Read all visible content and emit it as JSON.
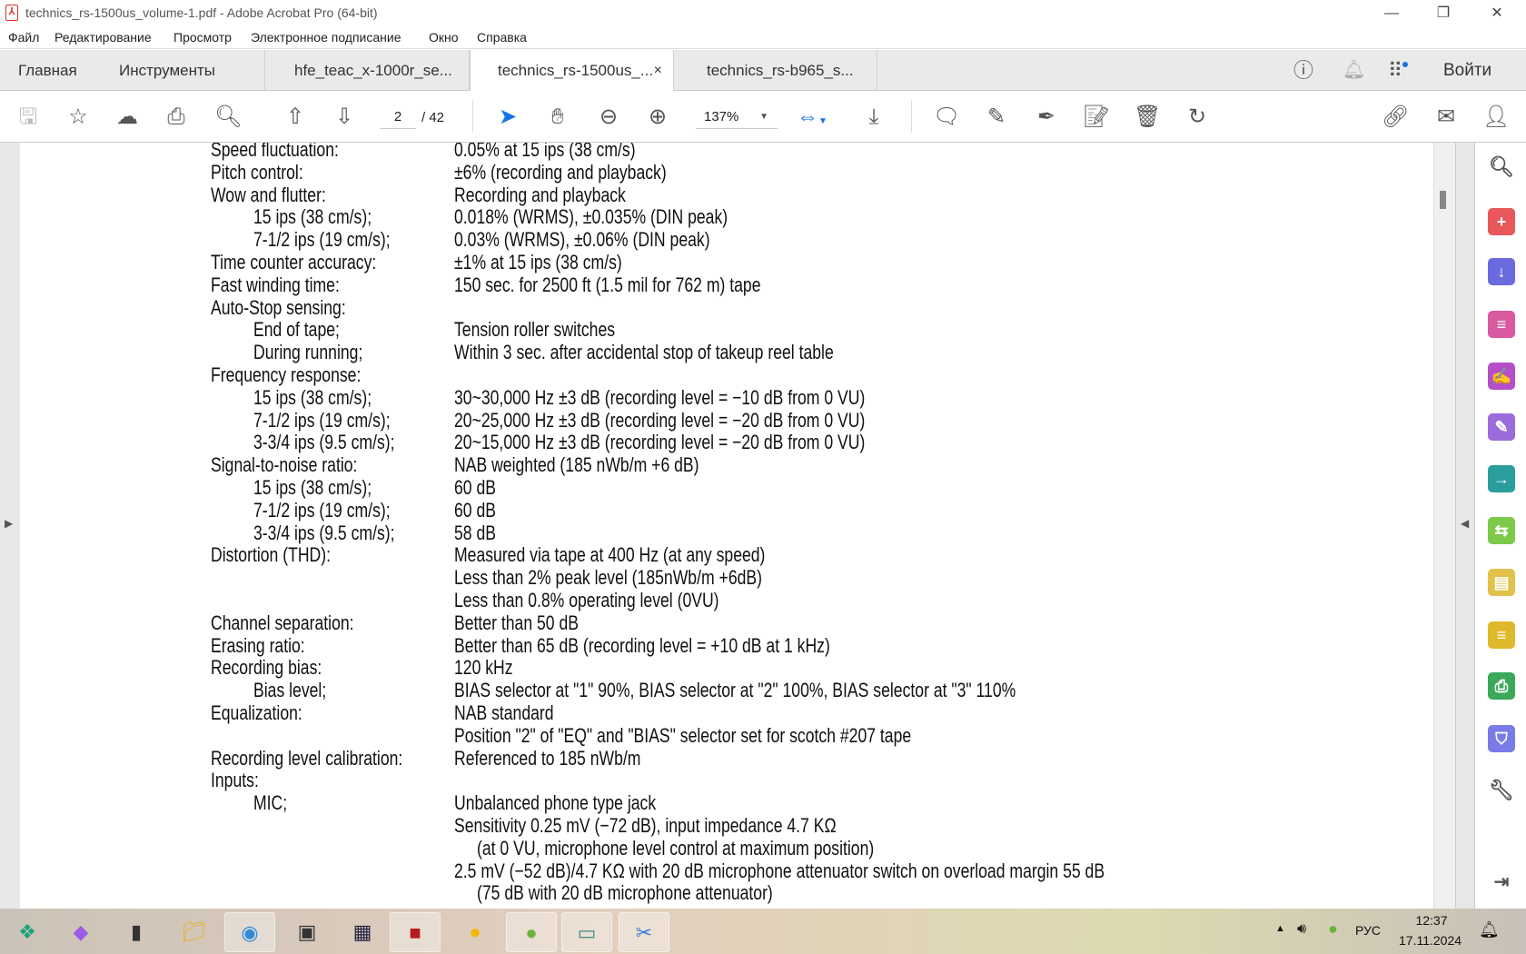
{
  "window": {
    "title": "technics_rs-1500us_volume-1.pdf - Adobe Acrobat Pro (64-bit)"
  },
  "menu": [
    "Файл",
    "Редактирование",
    "Просмотр",
    "Электронное подписание",
    "Окно",
    "Справка"
  ],
  "nav": {
    "home": "Главная",
    "tools": "Инструменты",
    "signin": "Войти"
  },
  "tabs": [
    {
      "label": "hfe_teac_x-1000r_se...",
      "active": false
    },
    {
      "label": "technics_rs-1500us_...",
      "active": true,
      "close": "×"
    },
    {
      "label": "technics_rs-b965_s...",
      "active": false
    }
  ],
  "toolbar": {
    "page_current": "2",
    "page_total": "/ 42",
    "zoom": "137%"
  },
  "document": {
    "rows": [
      {
        "label": "Speed fluctuation:",
        "value": "0.05% at 15 ips (38 cm/s)"
      },
      {
        "label": "Pitch control:",
        "value": "±6% (recording and playback)"
      },
      {
        "label": "Wow and flutter:",
        "value": "Recording and playback"
      },
      {
        "label": "15 ips (38 cm/s);",
        "sub": true,
        "value": "0.018% (WRMS), ±0.035% (DIN peak)"
      },
      {
        "label": "7-1/2 ips (19 cm/s);",
        "sub": true,
        "value": "0.03% (WRMS), ±0.06% (DIN peak)"
      },
      {
        "label": "Time counter accuracy:",
        "value": "±1% at 15 ips (38 cm/s)"
      },
      {
        "label": "Fast winding time:",
        "value": "150 sec. for 2500 ft (1.5 mil for 762 m) tape"
      },
      {
        "label": "Auto-Stop sensing:",
        "value": ""
      },
      {
        "label": "End of tape;",
        "sub": true,
        "value": "Tension roller switches"
      },
      {
        "label": "During running;",
        "sub": true,
        "value": "Within 3 sec. after accidental stop of takeup reel table"
      },
      {
        "label": "Frequency response:",
        "value": ""
      },
      {
        "label": "15 ips (38 cm/s);",
        "sub": true,
        "value": "30~30,000 Hz  ±3 dB (recording level = −10 dB from 0 VU)"
      },
      {
        "label": "7-1/2 ips (19 cm/s);",
        "sub": true,
        "value": "20~25,000 Hz  ±3 dB (recording level = −20 dB from 0 VU)"
      },
      {
        "label": "3-3/4 ips (9.5 cm/s);",
        "sub": true,
        "value": "20~15,000 Hz  ±3 dB (recording level = −20 dB from 0 VU)"
      },
      {
        "label": "Signal-to-noise ratio:",
        "value": "NAB weighted (185 nWb/m +6 dB)"
      },
      {
        "label": "15 ips (38 cm/s);",
        "sub": true,
        "value": "60 dB"
      },
      {
        "label": "7-1/2 ips (19 cm/s);",
        "sub": true,
        "value": "60 dB"
      },
      {
        "label": "3-3/4 ips (9.5 cm/s);",
        "sub": true,
        "value": "58 dB"
      },
      {
        "label": "Distortion (THD):",
        "value": "Measured via tape at 400 Hz (at any speed)"
      },
      {
        "label": "",
        "value": "Less than 2% peak level (185nWb/m +6dB)"
      },
      {
        "label": "",
        "value": "Less than 0.8% operating level (0VU)"
      },
      {
        "label": "Channel separation:",
        "value": "Better than 50 dB"
      },
      {
        "label": "Erasing ratio:",
        "value": "Better than 65 dB (recording level = +10 dB at 1 kHz)"
      },
      {
        "label": "Recording bias:",
        "value": "120 kHz"
      },
      {
        "label": "Bias level;",
        "sub": true,
        "value": "BIAS selector at \"1\" 90%, BIAS selector at \"2\" 100%, BIAS selector at \"3\" 110%"
      },
      {
        "label": "Equalization:",
        "value": "NAB standard"
      },
      {
        "label": "",
        "value": "Position \"2\" of \"EQ\" and \"BIAS\" selector set for scotch #207 tape"
      },
      {
        "label": "Recording level calibration:",
        "value": "Referenced to 185 nWb/m"
      },
      {
        "label": "Inputs:",
        "value": ""
      },
      {
        "label": "MIC;",
        "sub": true,
        "value": "Unbalanced phone type jack"
      },
      {
        "label": "",
        "value": "Sensitivity 0.25 mV (−72 dB), input impedance 4.7 KΩ"
      },
      {
        "label": "",
        "indent": true,
        "value": "(at 0 VU, microphone level control at maximum position)"
      },
      {
        "label": "",
        "value": "2.5 mV (−52 dB)/4.7 KΩ with 20 dB microphone attenuator switch on overload margin 55 dB"
      },
      {
        "label": "",
        "indent": true,
        "value": "(75 dB with 20 dB microphone attenuator)"
      }
    ]
  },
  "tray": {
    "lang": "РУС",
    "time": "12:37",
    "date": "17.11.2024"
  }
}
